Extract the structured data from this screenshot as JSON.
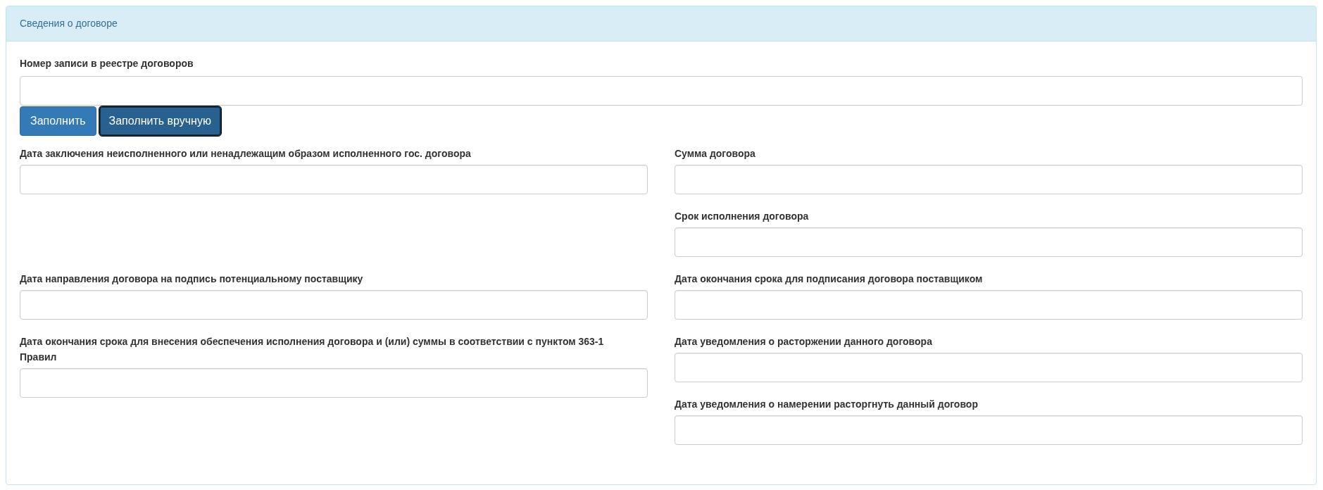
{
  "panel": {
    "title": "Сведения о договоре"
  },
  "registry_field": {
    "label": "Номер записи в реестре договоров"
  },
  "buttons": [
    {
      "label": "Заполнить",
      "focused": false
    },
    {
      "label": "Заполнить вручную",
      "focused": true
    }
  ],
  "rows": [
    {
      "left": [
        {
          "label": "Дата заключения неисполненного или ненадлежащим образом исполненного гос. договора"
        }
      ],
      "right": [
        {
          "label": "Сумма договора"
        },
        {
          "label": "Срок исполнения договора"
        }
      ]
    },
    {
      "left": [
        {
          "label": "Дата направления договора на подпись потенциальному поставщику"
        }
      ],
      "right": [
        {
          "label": "Дата окончания срока для подписания договора поставщиком"
        }
      ]
    },
    {
      "left": [
        {
          "label": "Дата окончания срока для внесения обеспечения исполнения договора и (или) суммы в соответствии с пунктом 363-1 Правил"
        }
      ],
      "right": [
        {
          "label": "Дата уведомления о расторжении данного договора"
        },
        {
          "label": "Дата уведомления о намерении расторгнуть данный договор"
        }
      ]
    }
  ]
}
